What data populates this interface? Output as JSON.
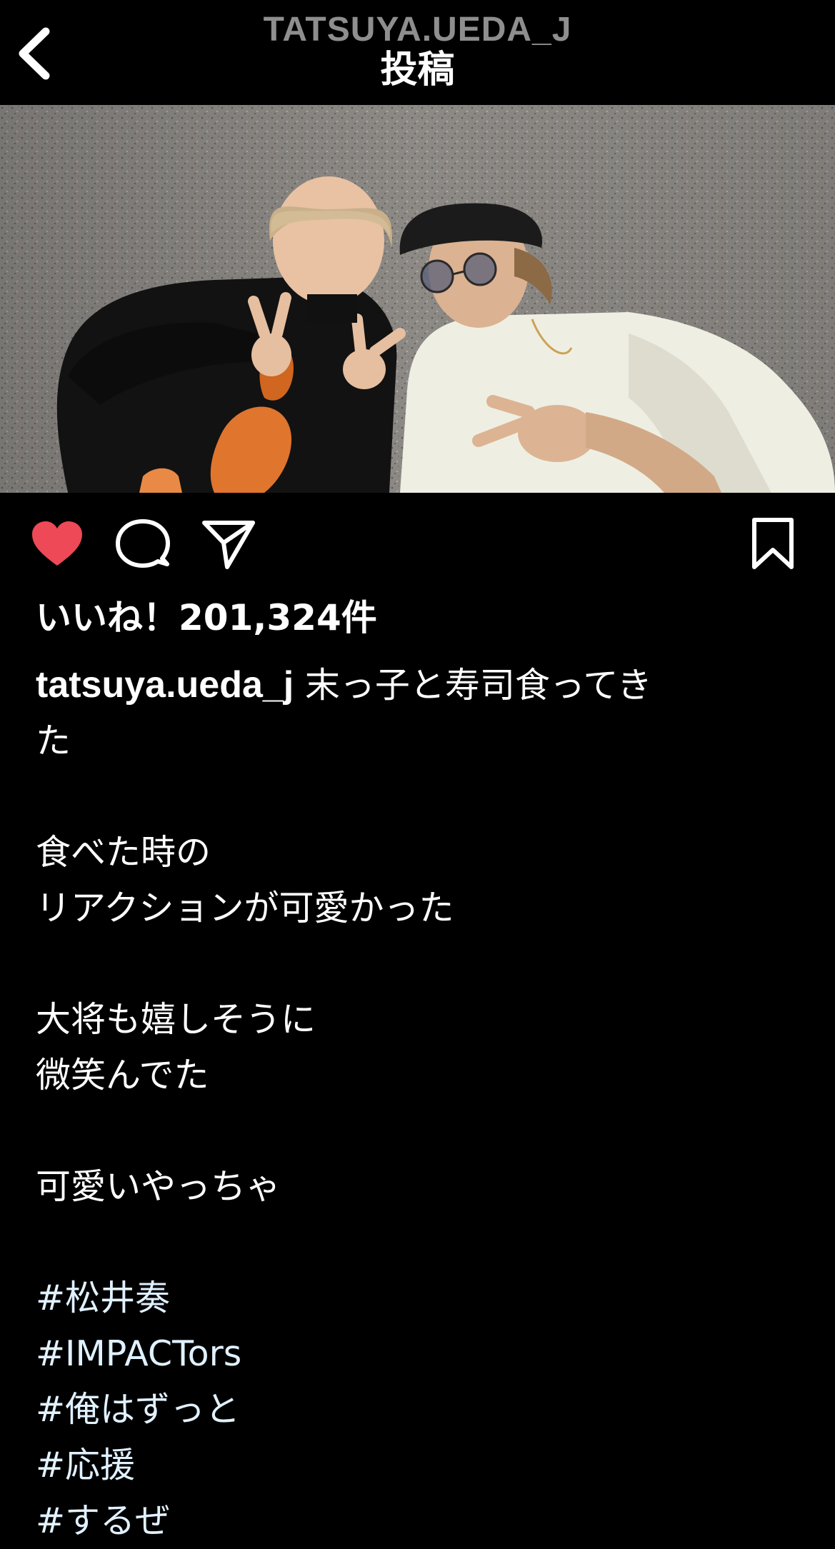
{
  "header": {
    "username": "TATSUYA.UEDA_J",
    "title": "投稿"
  },
  "icons": {
    "back": "chevron-left-icon",
    "like": "heart-filled-icon",
    "comment": "comment-bubble-icon",
    "share": "paper-plane-icon",
    "save": "bookmark-icon"
  },
  "colors": {
    "background": "#000000",
    "like_red": "#ed4956",
    "header_username": "#8e8e8e",
    "hashtag": "#e0f1ff"
  },
  "post": {
    "likes_text": "いいね！201,324件",
    "caption": {
      "username": "tatsuya.ueda_j",
      "first_line": "末っ子と寿司食ってき",
      "first_line_wrap": "た",
      "paragraph1": [
        "食べた時の",
        "リアクションが可愛かった"
      ],
      "paragraph2": [
        "大将も嬉しそうに",
        "微笑んでた"
      ],
      "paragraph3": [
        "可愛いやっちゃ"
      ],
      "hashtags": [
        "#松井奏",
        "#IMPACTors",
        "#俺はずっと",
        "#応援",
        "#するぜ"
      ]
    }
  }
}
